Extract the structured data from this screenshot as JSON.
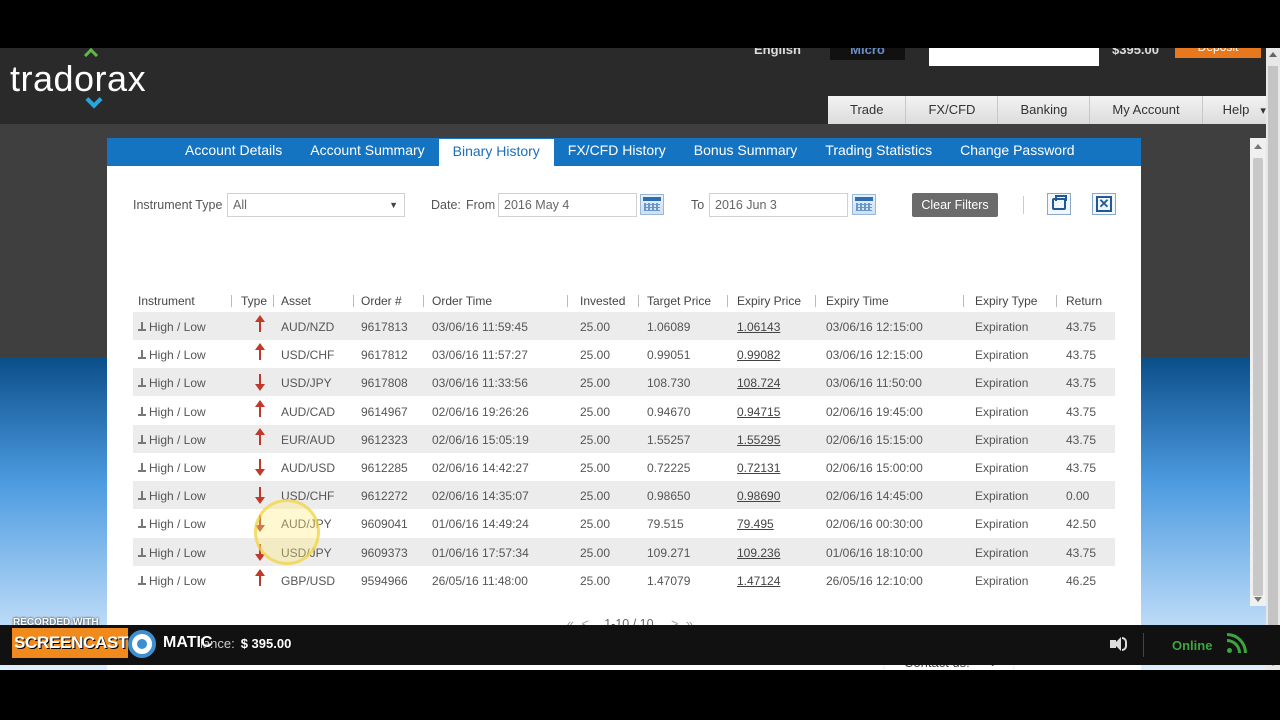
{
  "brand": {
    "logo_text": "tradorax"
  },
  "topbar": {
    "language": "English",
    "account_type": "Micro",
    "balance": "$395.00",
    "deposit_label": "Deposit"
  },
  "main_nav": [
    "Trade",
    "FX/CFD",
    "Banking",
    "My Account",
    "Help"
  ],
  "tabs": [
    "Account Details",
    "Account Summary",
    "Binary History",
    "FX/CFD History",
    "Bonus Summary",
    "Trading Statistics",
    "Change Password"
  ],
  "active_tab": "Binary History",
  "filters": {
    "instrument_type_label": "Instrument Type",
    "instrument_type_value": "All",
    "date_label": "Date:",
    "from_label": "From",
    "from_value": "2016 May 4",
    "to_label": "To",
    "to_value": "2016 Jun 3",
    "clear_label": "Clear Filters"
  },
  "table": {
    "headers": [
      "Instrument",
      "Type",
      "Asset",
      "Order #",
      "Order Time",
      "Invested",
      "Target Price",
      "Expiry Price",
      "Expiry Time",
      "Expiry Type",
      "Return"
    ],
    "rows": [
      {
        "instrument": "High / Low",
        "direction": "up",
        "asset": "AUD/NZD",
        "order": "9617813",
        "order_time": "03/06/16 11:59:45",
        "invested": "25.00",
        "target": "1.06089",
        "expiry_price": "1.06143",
        "expiry_time": "03/06/16 12:15:00",
        "expiry_type": "Expiration",
        "return": "43.75"
      },
      {
        "instrument": "High / Low",
        "direction": "up",
        "asset": "USD/CHF",
        "order": "9617812",
        "order_time": "03/06/16 11:57:27",
        "invested": "25.00",
        "target": "0.99051",
        "expiry_price": "0.99082",
        "expiry_time": "03/06/16 12:15:00",
        "expiry_type": "Expiration",
        "return": "43.75"
      },
      {
        "instrument": "High / Low",
        "direction": "down",
        "asset": "USD/JPY",
        "order": "9617808",
        "order_time": "03/06/16 11:33:56",
        "invested": "25.00",
        "target": "108.730",
        "expiry_price": "108.724",
        "expiry_time": "03/06/16 11:50:00",
        "expiry_type": "Expiration",
        "return": "43.75"
      },
      {
        "instrument": "High / Low",
        "direction": "up",
        "asset": "AUD/CAD",
        "order": "9614967",
        "order_time": "02/06/16 19:26:26",
        "invested": "25.00",
        "target": "0.94670",
        "expiry_price": "0.94715",
        "expiry_time": "02/06/16 19:45:00",
        "expiry_type": "Expiration",
        "return": "43.75"
      },
      {
        "instrument": "High / Low",
        "direction": "up",
        "asset": "EUR/AUD",
        "order": "9612323",
        "order_time": "02/06/16 15:05:19",
        "invested": "25.00",
        "target": "1.55257",
        "expiry_price": "1.55295",
        "expiry_time": "02/06/16 15:15:00",
        "expiry_type": "Expiration",
        "return": "43.75"
      },
      {
        "instrument": "High / Low",
        "direction": "down",
        "asset": "AUD/USD",
        "order": "9612285",
        "order_time": "02/06/16 14:42:27",
        "invested": "25.00",
        "target": "0.72225",
        "expiry_price": "0.72131",
        "expiry_time": "02/06/16 15:00:00",
        "expiry_type": "Expiration",
        "return": "43.75"
      },
      {
        "instrument": "High / Low",
        "direction": "down",
        "asset": "USD/CHF",
        "order": "9612272",
        "order_time": "02/06/16 14:35:07",
        "invested": "25.00",
        "target": "0.98650",
        "expiry_price": "0.98690",
        "expiry_time": "02/06/16 14:45:00",
        "expiry_type": "Expiration",
        "return": "0.00"
      },
      {
        "instrument": "High / Low",
        "direction": "down",
        "asset": "AUD/JPY",
        "order": "9609041",
        "order_time": "01/06/16 14:49:24",
        "invested": "25.00",
        "target": "79.515",
        "expiry_price": "79.495",
        "expiry_time": "02/06/16 00:30:00",
        "expiry_type": "Expiration",
        "return": "42.50"
      },
      {
        "instrument": "High / Low",
        "direction": "down",
        "asset": "USD/JPY",
        "order": "9609373",
        "order_time": "01/06/16 17:57:34",
        "invested": "25.00",
        "target": "109.271",
        "expiry_price": "109.236",
        "expiry_time": "01/06/16 18:10:00",
        "expiry_type": "Expiration",
        "return": "43.75"
      },
      {
        "instrument": "High / Low",
        "direction": "up",
        "asset": "GBP/USD",
        "order": "9594966",
        "order_time": "26/05/16 11:48:00",
        "invested": "25.00",
        "target": "1.47079",
        "expiry_price": "1.47124",
        "expiry_time": "26/05/16 12:10:00",
        "expiry_type": "Expiration",
        "return": "46.25"
      }
    ]
  },
  "pager": {
    "first": "«",
    "prev": "<",
    "summary": "1-10 / 10",
    "next": ">",
    "last": "»"
  },
  "contact": {
    "label": "Contact us!",
    "plus": "+"
  },
  "footer": {
    "balance_label": "lance:",
    "balance_value": "$ 395.00",
    "online": "Online"
  },
  "watermark": {
    "recorded": "RECORDED WITH",
    "brand_a": "SCREENCAST",
    "brand_b": "MATIC"
  },
  "colors": {
    "tab_bar": "#1474c2",
    "arrow": "#c0392b",
    "clear_button": "#6b6b6b",
    "online": "#3fa43f",
    "deposit": "#e8781e"
  },
  "icons": {
    "calendar": "calendar-icon",
    "print": "print-icon",
    "export": "excel-export-icon",
    "arrow_up": "arrow-up-icon",
    "arrow_down": "arrow-down-icon"
  }
}
